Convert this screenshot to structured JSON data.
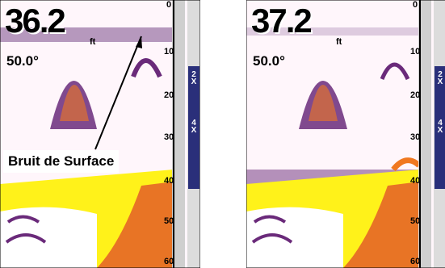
{
  "screens": [
    {
      "depth": "36.2",
      "unit": "ft",
      "temperature": "50.0°",
      "scale": [
        "0",
        "10",
        "20",
        "30",
        "40",
        "50",
        "60"
      ],
      "zoom": [
        "2",
        "X",
        "4",
        "X"
      ]
    },
    {
      "depth": "37.2",
      "unit": "ft",
      "temperature": "50.0°",
      "scale": [
        "0",
        "10",
        "20",
        "30",
        "40",
        "50",
        "60"
      ],
      "zoom": [
        "2",
        "X",
        "4",
        "X"
      ]
    }
  ],
  "annotation": {
    "label": "Bruit de Surface"
  },
  "colors": {
    "water": "#fff6fb",
    "bottom": "#fff21a",
    "echo": "#6a2a7a",
    "echo_hot": "#f07820",
    "bar": "#2a2f7a"
  }
}
